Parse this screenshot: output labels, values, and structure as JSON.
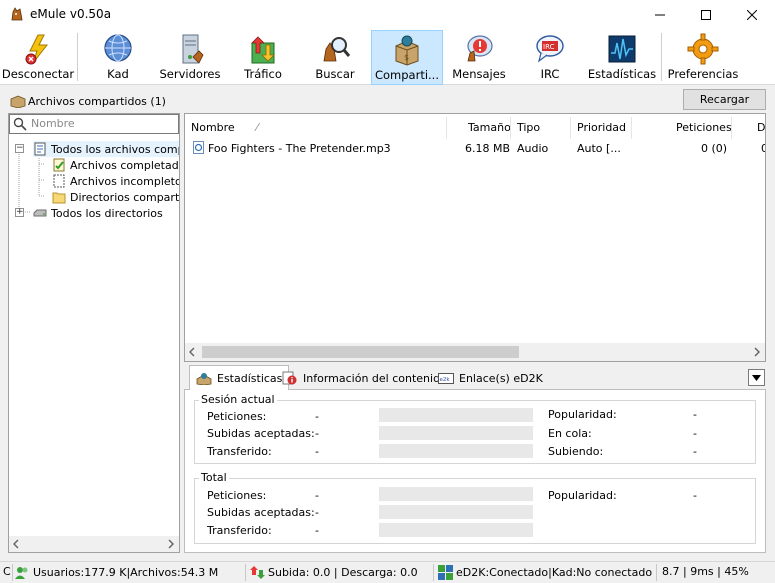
{
  "window": {
    "title": "eMule v0.50a",
    "app_icon": "emule-mule-icon",
    "minimize_icon": "minimize-icon",
    "maximize_icon": "maximize-icon",
    "close_icon": "close-icon"
  },
  "toolbar": {
    "items": [
      {
        "label": "Desconectar",
        "icon": "disconnect-lightning-icon"
      },
      {
        "label": "Kad",
        "icon": "kad-globe-icon"
      },
      {
        "label": "Servidores",
        "icon": "servers-icon"
      },
      {
        "label": "Tráfico",
        "icon": "traffic-arrows-icon"
      },
      {
        "label": "Buscar",
        "icon": "search-magnifier-icon"
      },
      {
        "label": "Comparti...",
        "icon": "shared-files-box-icon"
      },
      {
        "label": "Mensajes",
        "icon": "messages-bubble-icon"
      },
      {
        "label": "IRC",
        "icon": "irc-bubble-icon"
      },
      {
        "label": "Estadísticas",
        "icon": "statistics-graph-icon"
      },
      {
        "label": "Preferencias",
        "icon": "preferences-gear-icon"
      }
    ],
    "active_index": 5
  },
  "shared": {
    "title": "Archivos compartidos (1)",
    "reload_label": "Recargar",
    "search_placeholder": "Nombre"
  },
  "tree": {
    "items": [
      {
        "label": "Todos los archivos compartidos",
        "icon": "shared-files-icon"
      },
      {
        "label": "Archivos completados",
        "icon": "completed-files-icon"
      },
      {
        "label": "Archivos incompletos",
        "icon": "incomplete-files-icon"
      },
      {
        "label": "Directorios compartidos",
        "icon": "folder-icon"
      },
      {
        "label": "Todos los directorios",
        "icon": "drive-icon"
      }
    ]
  },
  "file_list": {
    "columns": [
      "Nombre",
      "Tamaño",
      "Tipo",
      "Prioridad",
      "Peticiones",
      "Da"
    ],
    "rows": [
      {
        "name": "Foo Fighters - The Pretender.mp3",
        "size": "6.18 MB",
        "type": "Audio",
        "priority": "Auto [...",
        "requests": "0 (0)",
        "extra": "0"
      }
    ]
  },
  "tabs": {
    "items": [
      {
        "label": "Estadísticas",
        "icon": "statistics-tab-icon"
      },
      {
        "label": "Información del contenido",
        "icon": "info-tab-icon"
      },
      {
        "label": "Enlace(s) eD2K",
        "icon": "ed2k-link-icon"
      }
    ],
    "selected_index": 0
  },
  "stats": {
    "session": {
      "title": "Sesión actual",
      "left": [
        {
          "label": "Peticiones:",
          "value": "-"
        },
        {
          "label": "Subidas aceptadas:",
          "value": "-"
        },
        {
          "label": "Transferido:",
          "value": "-"
        }
      ],
      "right": [
        {
          "label": "Popularidad:",
          "value": "-"
        },
        {
          "label": "En cola:",
          "value": "-"
        },
        {
          "label": "Subiendo:",
          "value": "-"
        }
      ]
    },
    "total": {
      "title": "Total",
      "left": [
        {
          "label": "Peticiones:",
          "value": "-"
        },
        {
          "label": "Subidas aceptadas:",
          "value": "-"
        },
        {
          "label": "Transferido:",
          "value": "-"
        }
      ],
      "right": [
        {
          "label": "Popularidad:",
          "value": "-"
        }
      ]
    }
  },
  "status_bar": {
    "first": "C",
    "users": "Usuarios:177.9 K|Archivos:54.3 M",
    "transfer": "Subida: 0.0 | Descarga: 0.0",
    "network": "eD2K:Conectado|Kad:No conectado",
    "extra": "8.7 | 9ms | 45%"
  },
  "colors": {
    "active_tab_bg": "#cce8ff",
    "active_tab_border": "#99d1ff",
    "window_bg": "#f0f0f0"
  }
}
